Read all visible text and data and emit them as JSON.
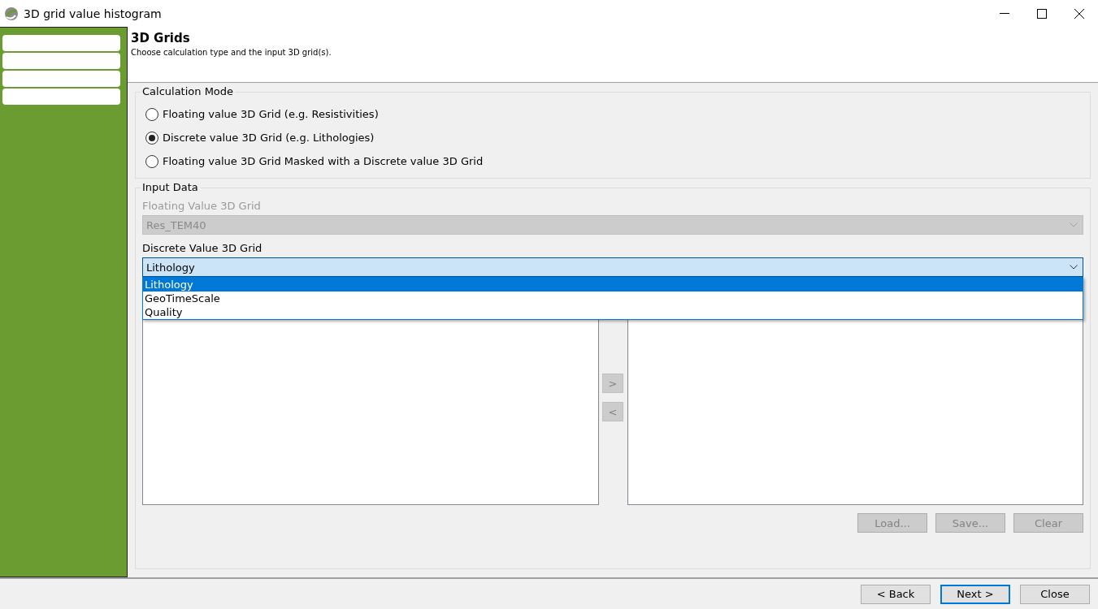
{
  "window": {
    "title": "3D grid value histogram"
  },
  "sidebar": {
    "items": [
      {
        "selected": false
      },
      {
        "selected": false
      },
      {
        "selected": false
      },
      {
        "selected": false
      }
    ]
  },
  "header": {
    "title": "3D Grids",
    "subtitle": "Choose calculation type and the input 3D grid(s)."
  },
  "calculation_mode": {
    "title": "Calculation Mode",
    "options": [
      {
        "label": "Floating value 3D Grid (e.g. Resistivities)",
        "selected": false
      },
      {
        "label": "Discrete value 3D Grid (e.g. Lithologies)",
        "selected": true
      },
      {
        "label": "Floating value 3D Grid Masked with a Discrete value 3D Grid",
        "selected": false
      }
    ]
  },
  "input_data": {
    "title": "Input Data",
    "floating_grid": {
      "label": "Floating Value 3D Grid",
      "value": "Res_TEM40",
      "disabled": true
    },
    "discrete_grid": {
      "label": "Discrete Value 3D Grid",
      "value": "Lithology",
      "disabled": false,
      "expanded": true,
      "options": [
        {
          "label": "Lithology",
          "selected": true
        },
        {
          "label": "GeoTimeScale",
          "selected": false
        },
        {
          "label": "Quality",
          "selected": false
        }
      ]
    },
    "move_buttons": [
      {
        "label": ">",
        "disabled": true
      },
      {
        "label": "<",
        "disabled": true
      }
    ],
    "list_buttons": [
      {
        "label": "Load...",
        "disabled": true
      },
      {
        "label": "Save...",
        "disabled": true
      },
      {
        "label": "Clear",
        "disabled": true
      }
    ]
  },
  "footer_buttons": [
    {
      "label": "< Back",
      "default": false
    },
    {
      "label": "Next >",
      "default": true
    },
    {
      "label": "Close",
      "default": false
    }
  ]
}
